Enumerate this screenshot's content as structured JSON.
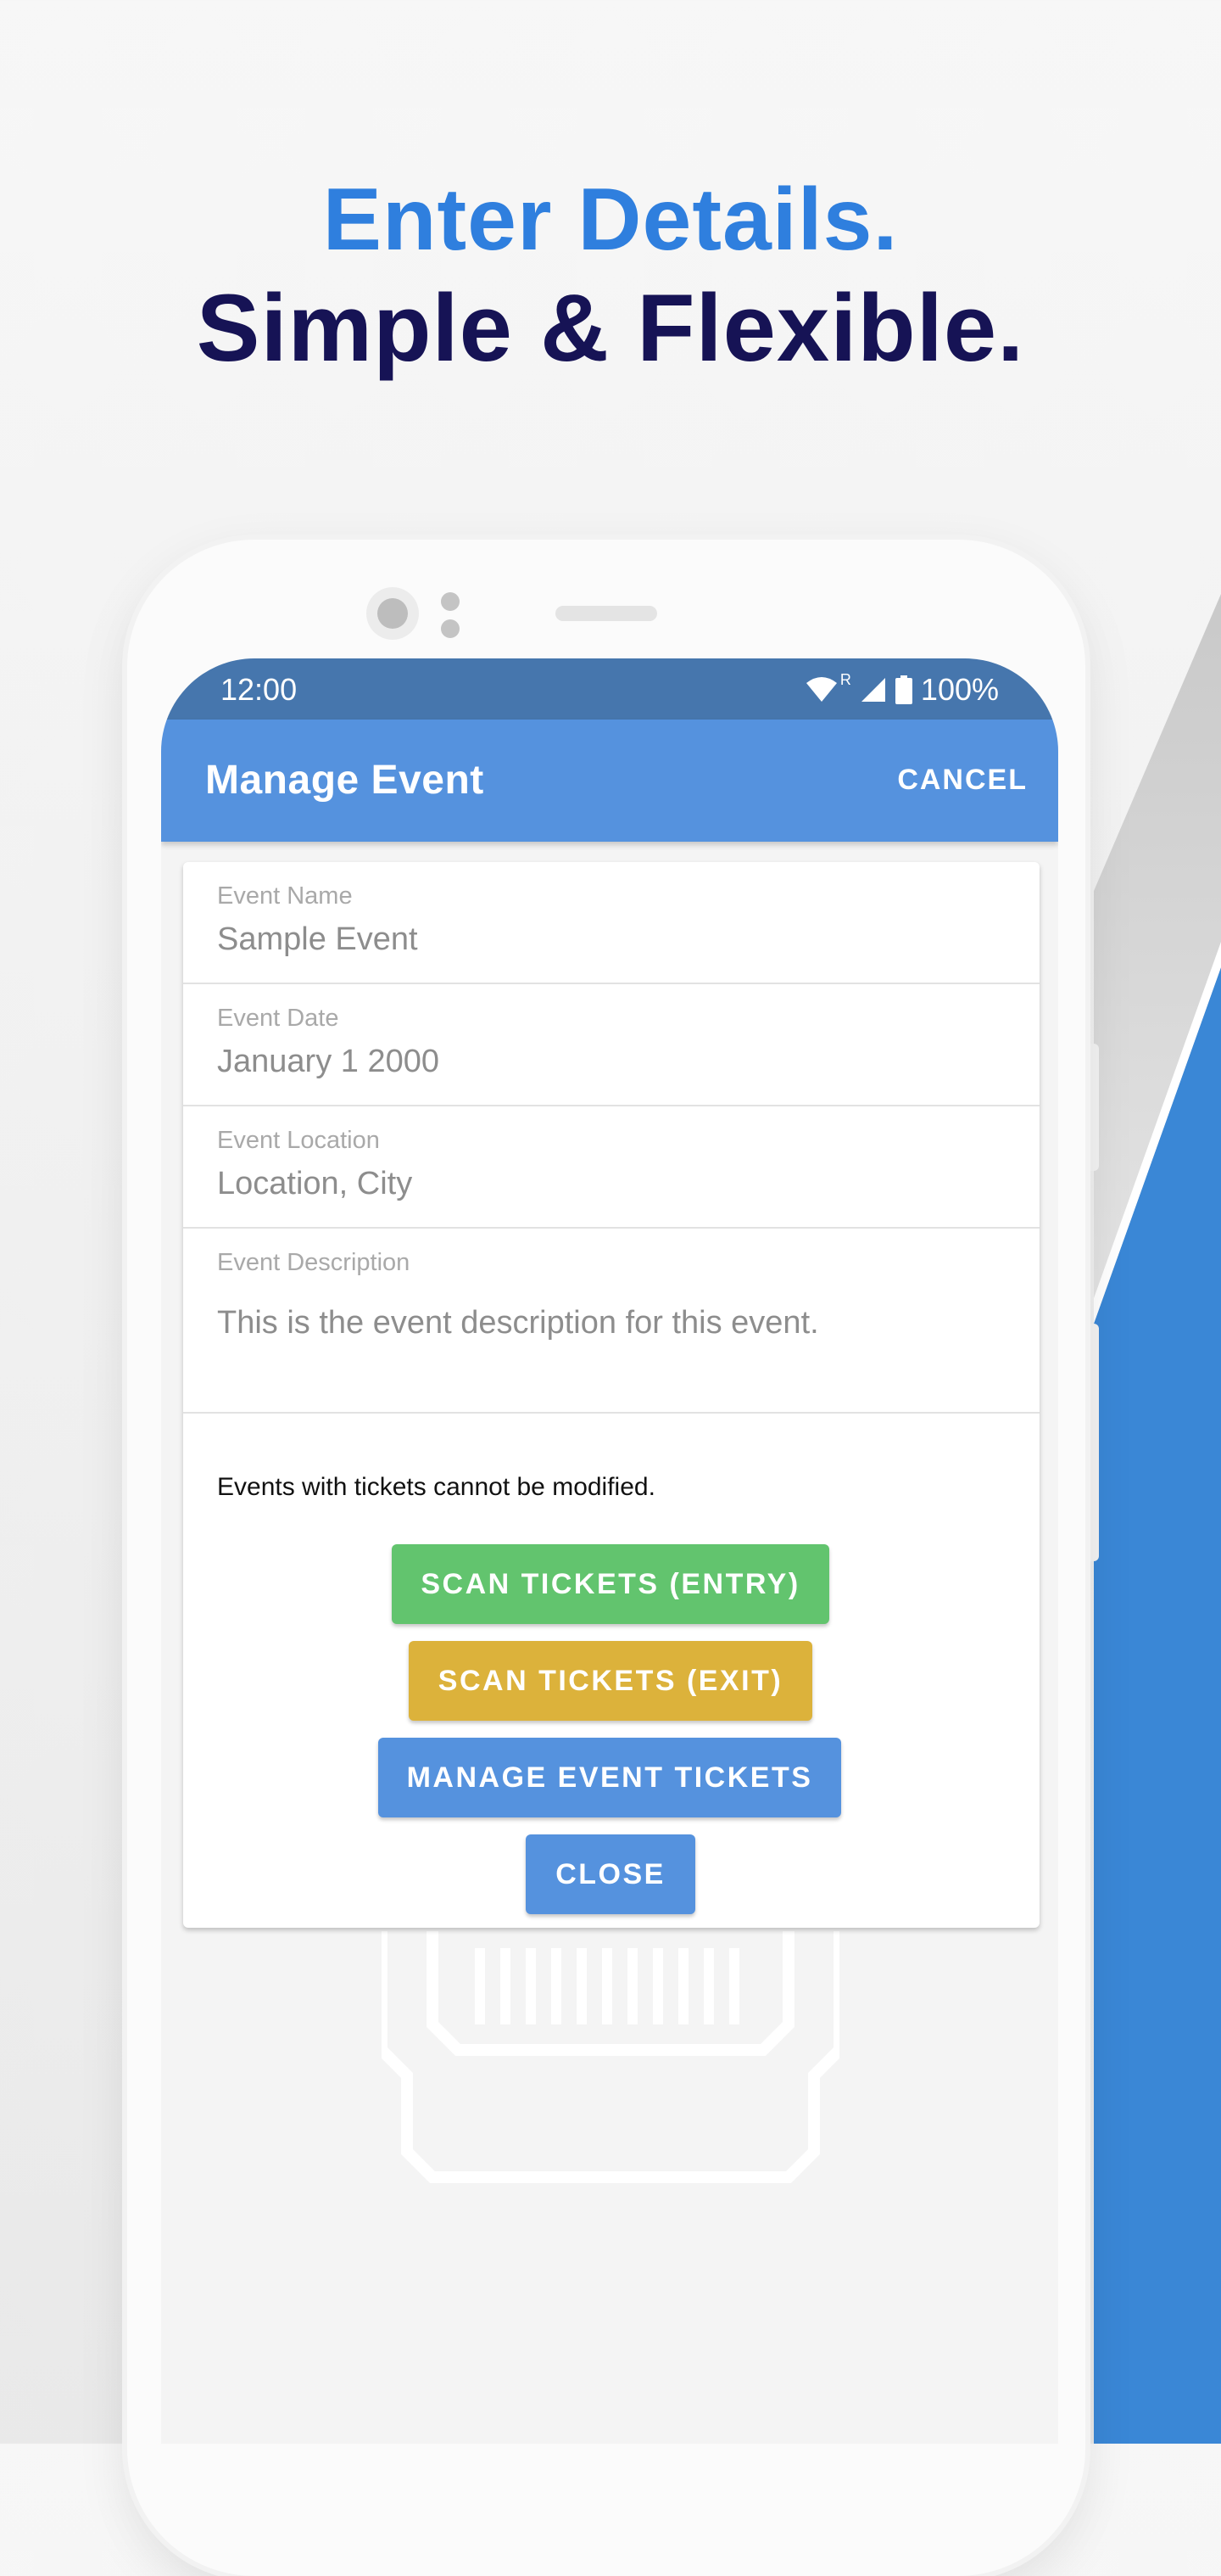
{
  "headline": {
    "line1": "Enter Details.",
    "line2": "Simple & Flexible."
  },
  "colors": {
    "headline_accent": "#2f7fde",
    "headline_dark": "#161355",
    "status_bar": "#4676ad",
    "app_bar": "#5592de",
    "entry_button": "#62c46e",
    "exit_button": "#dcb23b",
    "manage_button": "#5592de",
    "close_button": "#5592de",
    "decor_blue": "#3a87d6"
  },
  "status_bar": {
    "time": "12:00",
    "battery": "100%",
    "icons": [
      "wifi-icon",
      "roaming-indicator",
      "cell-signal-icon",
      "battery-icon"
    ],
    "roaming": "R"
  },
  "app_bar": {
    "title": "Manage Event",
    "cancel_label": "CANCEL"
  },
  "form": {
    "fields": [
      {
        "label": "Event Name",
        "value": "Sample Event"
      },
      {
        "label": "Event Date",
        "value": "January 1 2000"
      },
      {
        "label": "Event Location",
        "value": "Location, City"
      },
      {
        "label": "Event Description",
        "value": "This is the event description for this event."
      }
    ],
    "notice": "Events with tickets cannot be modified."
  },
  "actions": {
    "scan_entry": "SCAN TICKETS (ENTRY)",
    "scan_exit": "SCAN TICKETS (EXIT)",
    "manage_tickets": "MANAGE EVENT TICKETS",
    "close": "CLOSE"
  }
}
